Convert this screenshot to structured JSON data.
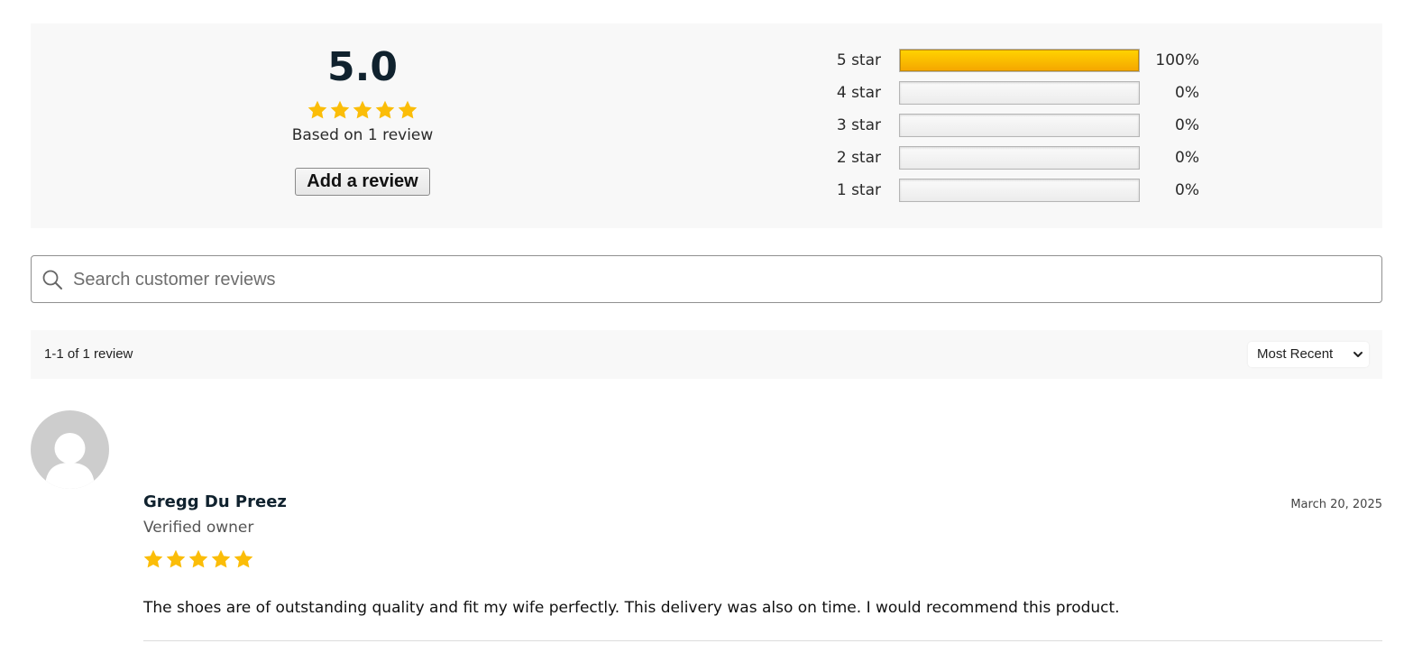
{
  "summary": {
    "average": "5.0",
    "rating": 5,
    "based_on": "Based on 1 review",
    "add_review_label": "Add a review",
    "distribution": [
      {
        "label": "5 star",
        "percent": "100%",
        "fill": 1.0
      },
      {
        "label": "4 star",
        "percent": "0%",
        "fill": 0
      },
      {
        "label": "3 star",
        "percent": "0%",
        "fill": 0
      },
      {
        "label": "2 star",
        "percent": "0%",
        "fill": 0
      },
      {
        "label": "1 star",
        "percent": "0%",
        "fill": 0
      }
    ]
  },
  "search": {
    "placeholder": "Search customer reviews"
  },
  "toolbar": {
    "count": "1-1 of 1 review",
    "sort_label": "Most Recent"
  },
  "review": {
    "author": "Gregg Du Preez",
    "badge": "Verified owner",
    "rating": 5,
    "date": "March 20, 2025",
    "text": "The shoes are of outstanding quality and fit my wife perfectly. This delivery was also on time. I would recommend this product."
  },
  "colors": {
    "star": "#fbbd08",
    "bar_fill": "#ffc400"
  },
  "icons": {
    "search": "search-icon",
    "sort": "chevron-down-icon",
    "avatar": "user-avatar-icon",
    "star": "star-icon"
  }
}
